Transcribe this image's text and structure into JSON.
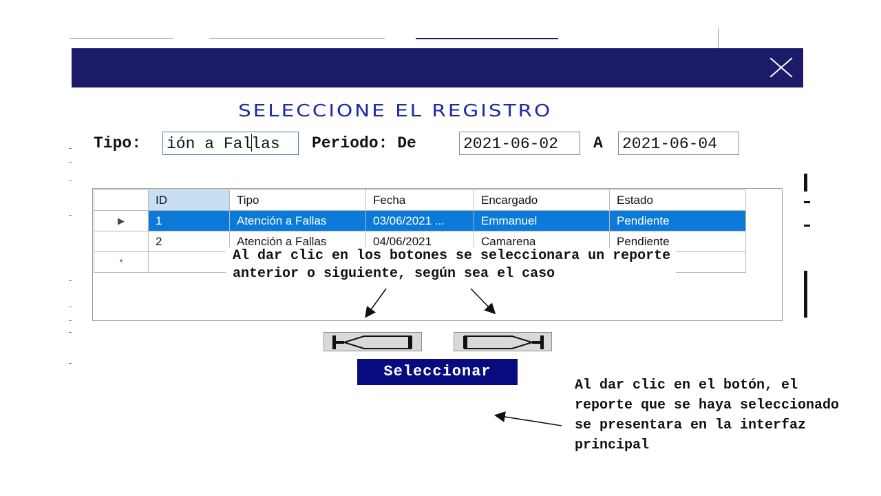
{
  "dialog": {
    "title": "SELECCIONE EL REGISTRO",
    "colors": {
      "titlebar": "#1b1b6a",
      "title_text": "#1e2aa8",
      "selected_row": "#0b7ad9",
      "select_button": "#080b80"
    }
  },
  "filters": {
    "tipo_label": "Tipo:",
    "tipo_before_caret": "ión a Fal",
    "tipo_after_caret": "las",
    "periodo_label": "Periodo: De",
    "date_from": "2021-06-02",
    "a_label": "A",
    "date_to": "2021-06-04"
  },
  "grid": {
    "columns": [
      "ID",
      "Tipo",
      "Fecha",
      "Encargado",
      "Estado"
    ],
    "rows": [
      {
        "indicator": "▶",
        "cells": [
          "1",
          "Atención a Fallas",
          "03/06/2021 ...",
          "Emmanuel",
          "Pendiente"
        ]
      },
      {
        "indicator": "",
        "cells": [
          "2",
          "Atención a Fallas",
          "04/06/2021",
          "Camarena",
          "Pendiente"
        ]
      }
    ],
    "new_row_indicator": "*"
  },
  "buttons": {
    "previous_icon": "first-previous-arrow-icon",
    "next_icon": "next-last-arrow-icon",
    "select_label": "Seleccionar"
  },
  "annotations": {
    "nav_line1": "Al dar clic en los botones se seleccionara un reporte",
    "nav_line2": "anterior o siguiente, según sea el caso",
    "select_line1": "Al dar clic en el botón, el",
    "select_line2": "reporte que se haya seleccionado",
    "select_line3": "se presentara en la interfaz",
    "select_line4": "principal"
  }
}
